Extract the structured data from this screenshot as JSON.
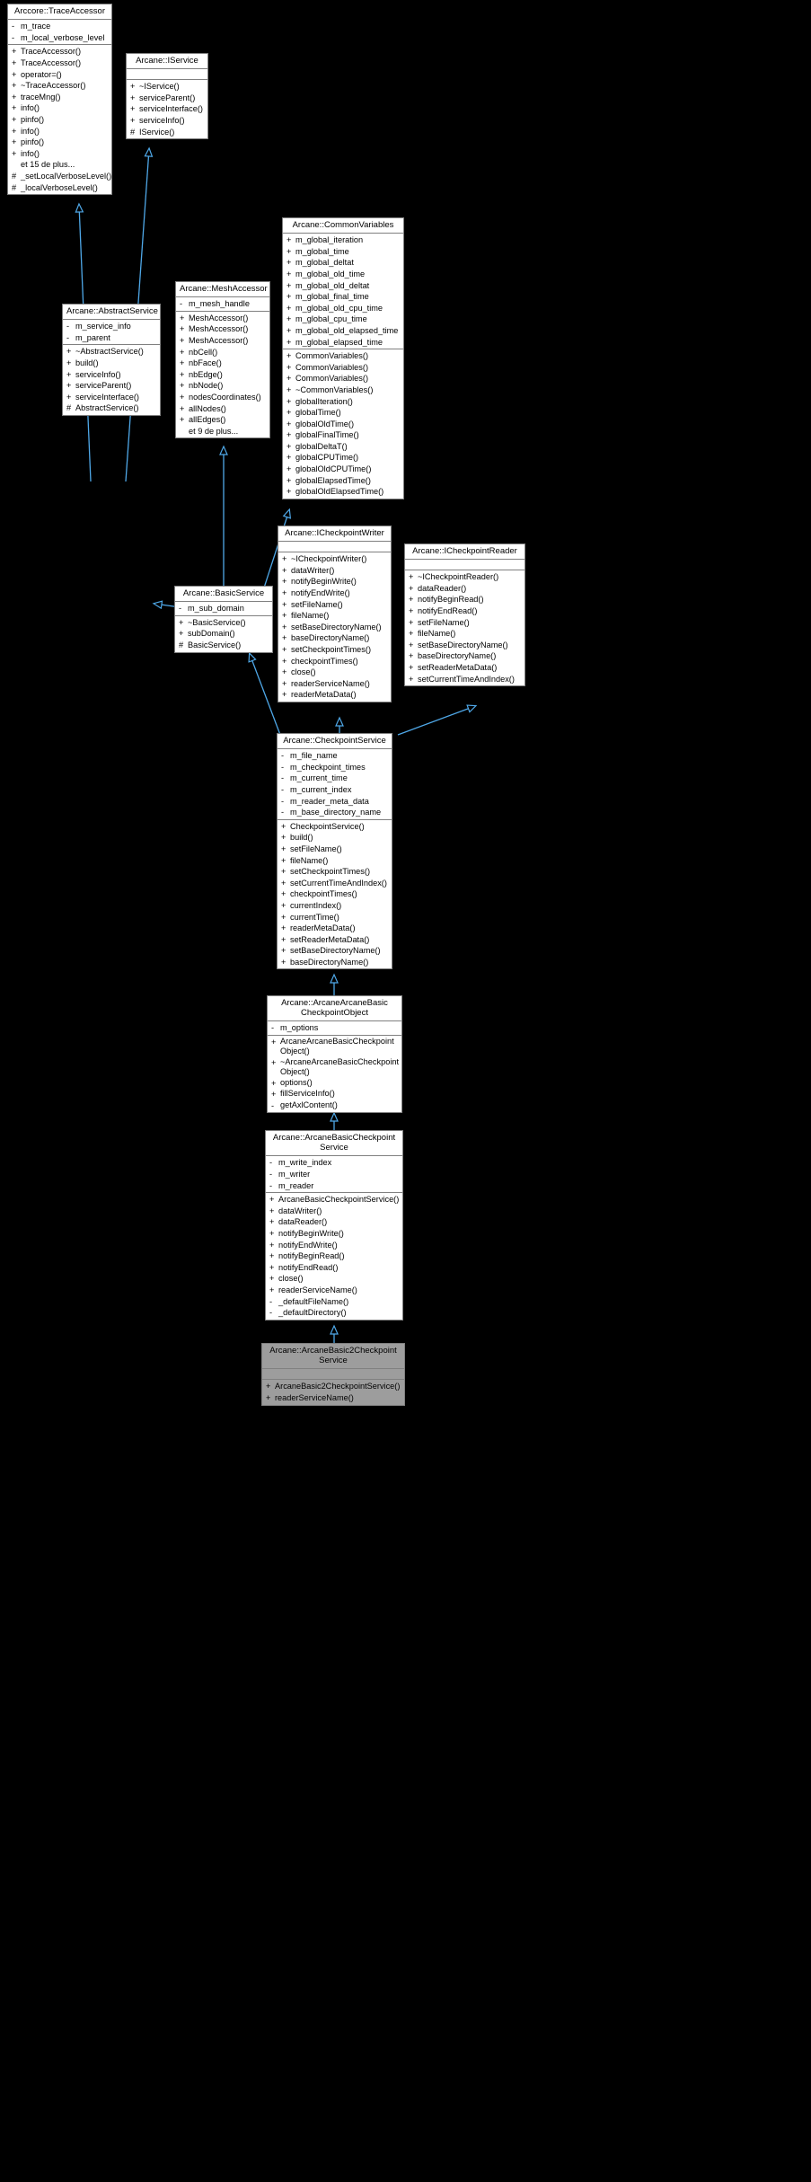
{
  "diagram": {
    "type": "uml-class-inheritance",
    "background": "#000000",
    "edge_color": "#4fa8e8",
    "node_fill": "#ffffff",
    "node_border": "#808080",
    "highlight_fill": "#9d9d9d"
  },
  "nodes": {
    "trace_accessor": {
      "title": "Arccore::TraceAccessor",
      "attributes": [
        {
          "vis": "-",
          "name": "m_trace"
        },
        {
          "vis": "-",
          "name": "m_local_verbose_level"
        }
      ],
      "methods": [
        {
          "vis": "+",
          "name": "TraceAccessor()"
        },
        {
          "vis": "+",
          "name": "TraceAccessor()"
        },
        {
          "vis": "+",
          "name": "operator=()"
        },
        {
          "vis": "+",
          "name": "~TraceAccessor()"
        },
        {
          "vis": "+",
          "name": "traceMng()"
        },
        {
          "vis": "+",
          "name": "info()"
        },
        {
          "vis": "+",
          "name": "pinfo()"
        },
        {
          "vis": "+",
          "name": "info()"
        },
        {
          "vis": "+",
          "name": "pinfo()"
        },
        {
          "vis": "+",
          "name": "info()"
        },
        {
          "vis": "",
          "name": "et 15 de plus..."
        },
        {
          "vis": "#",
          "name": "_setLocalVerboseLevel()"
        },
        {
          "vis": "#",
          "name": "_localVerboseLevel()"
        }
      ]
    },
    "iservice": {
      "title": "Arcane::IService",
      "attributes": [],
      "methods": [
        {
          "vis": "+",
          "name": "~IService()"
        },
        {
          "vis": "+",
          "name": "serviceParent()"
        },
        {
          "vis": "+",
          "name": "serviceInterface()"
        },
        {
          "vis": "+",
          "name": "serviceInfo()"
        },
        {
          "vis": "#",
          "name": "IService()"
        }
      ]
    },
    "abstract_service": {
      "title": "Arcane::AbstractService",
      "attributes": [
        {
          "vis": "-",
          "name": "m_service_info"
        },
        {
          "vis": "-",
          "name": "m_parent"
        }
      ],
      "methods": [
        {
          "vis": "+",
          "name": "~AbstractService()"
        },
        {
          "vis": "+",
          "name": "build()"
        },
        {
          "vis": "+",
          "name": "serviceInfo()"
        },
        {
          "vis": "+",
          "name": "serviceParent()"
        },
        {
          "vis": "+",
          "name": "serviceInterface()"
        },
        {
          "vis": "#",
          "name": "AbstractService()"
        }
      ]
    },
    "mesh_accessor": {
      "title": "Arcane::MeshAccessor",
      "attributes": [
        {
          "vis": "-",
          "name": "m_mesh_handle"
        }
      ],
      "methods": [
        {
          "vis": "+",
          "name": "MeshAccessor()"
        },
        {
          "vis": "+",
          "name": "MeshAccessor()"
        },
        {
          "vis": "+",
          "name": "MeshAccessor()"
        },
        {
          "vis": "+",
          "name": "nbCell()"
        },
        {
          "vis": "+",
          "name": "nbFace()"
        },
        {
          "vis": "+",
          "name": "nbEdge()"
        },
        {
          "vis": "+",
          "name": "nbNode()"
        },
        {
          "vis": "+",
          "name": "nodesCoordinates()"
        },
        {
          "vis": "+",
          "name": "allNodes()"
        },
        {
          "vis": "+",
          "name": "allEdges()"
        },
        {
          "vis": "",
          "name": "et 9 de plus..."
        }
      ]
    },
    "common_variables": {
      "title": "Arcane::CommonVariables",
      "attributes": [
        {
          "vis": "+",
          "name": "m_global_iteration"
        },
        {
          "vis": "+",
          "name": "m_global_time"
        },
        {
          "vis": "+",
          "name": "m_global_deltat"
        },
        {
          "vis": "+",
          "name": "m_global_old_time"
        },
        {
          "vis": "+",
          "name": "m_global_old_deltat"
        },
        {
          "vis": "+",
          "name": "m_global_final_time"
        },
        {
          "vis": "+",
          "name": "m_global_old_cpu_time"
        },
        {
          "vis": "+",
          "name": "m_global_cpu_time"
        },
        {
          "vis": "+",
          "name": "m_global_old_elapsed_time"
        },
        {
          "vis": "+",
          "name": "m_global_elapsed_time"
        }
      ],
      "methods": [
        {
          "vis": "+",
          "name": "CommonVariables()"
        },
        {
          "vis": "+",
          "name": "CommonVariables()"
        },
        {
          "vis": "+",
          "name": "CommonVariables()"
        },
        {
          "vis": "+",
          "name": "~CommonVariables()"
        },
        {
          "vis": "+",
          "name": "globalIteration()"
        },
        {
          "vis": "+",
          "name": "globalTime()"
        },
        {
          "vis": "+",
          "name": "globalOldTime()"
        },
        {
          "vis": "+",
          "name": "globalFinalTime()"
        },
        {
          "vis": "+",
          "name": "globalDeltaT()"
        },
        {
          "vis": "+",
          "name": "globalCPUTime()"
        },
        {
          "vis": "+",
          "name": "globalOldCPUTime()"
        },
        {
          "vis": "+",
          "name": "globalElapsedTime()"
        },
        {
          "vis": "+",
          "name": "globalOldElapsedTime()"
        }
      ]
    },
    "basic_service": {
      "title": "Arcane::BasicService",
      "attributes": [
        {
          "vis": "-",
          "name": "m_sub_domain"
        }
      ],
      "methods": [
        {
          "vis": "+",
          "name": "~BasicService()"
        },
        {
          "vis": "+",
          "name": "subDomain()"
        },
        {
          "vis": "#",
          "name": "BasicService()"
        }
      ]
    },
    "icheckpoint_writer": {
      "title": "Arcane::ICheckpointWriter",
      "attributes": [],
      "methods": [
        {
          "vis": "+",
          "name": "~ICheckpointWriter()"
        },
        {
          "vis": "+",
          "name": "dataWriter()"
        },
        {
          "vis": "+",
          "name": "notifyBeginWrite()"
        },
        {
          "vis": "+",
          "name": "notifyEndWrite()"
        },
        {
          "vis": "+",
          "name": "setFileName()"
        },
        {
          "vis": "+",
          "name": "fileName()"
        },
        {
          "vis": "+",
          "name": "setBaseDirectoryName()"
        },
        {
          "vis": "+",
          "name": "baseDirectoryName()"
        },
        {
          "vis": "+",
          "name": "setCheckpointTimes()"
        },
        {
          "vis": "+",
          "name": "checkpointTimes()"
        },
        {
          "vis": "+",
          "name": "close()"
        },
        {
          "vis": "+",
          "name": "readerServiceName()"
        },
        {
          "vis": "+",
          "name": "readerMetaData()"
        }
      ]
    },
    "icheckpoint_reader": {
      "title": "Arcane::ICheckpointReader",
      "attributes": [],
      "methods": [
        {
          "vis": "+",
          "name": "~ICheckpointReader()"
        },
        {
          "vis": "+",
          "name": "dataReader()"
        },
        {
          "vis": "+",
          "name": "notifyBeginRead()"
        },
        {
          "vis": "+",
          "name": "notifyEndRead()"
        },
        {
          "vis": "+",
          "name": "setFileName()"
        },
        {
          "vis": "+",
          "name": "fileName()"
        },
        {
          "vis": "+",
          "name": "setBaseDirectoryName()"
        },
        {
          "vis": "+",
          "name": "baseDirectoryName()"
        },
        {
          "vis": "+",
          "name": "setReaderMetaData()"
        },
        {
          "vis": "+",
          "name": "setCurrentTimeAndIndex()"
        }
      ]
    },
    "checkpoint_service": {
      "title": "Arcane::CheckpointService",
      "attributes": [
        {
          "vis": "-",
          "name": "m_file_name"
        },
        {
          "vis": "-",
          "name": "m_checkpoint_times"
        },
        {
          "vis": "-",
          "name": "m_current_time"
        },
        {
          "vis": "-",
          "name": "m_current_index"
        },
        {
          "vis": "-",
          "name": "m_reader_meta_data"
        },
        {
          "vis": "-",
          "name": "m_base_directory_name"
        }
      ],
      "methods": [
        {
          "vis": "+",
          "name": "CheckpointService()"
        },
        {
          "vis": "+",
          "name": "build()"
        },
        {
          "vis": "+",
          "name": "setFileName()"
        },
        {
          "vis": "+",
          "name": "fileName()"
        },
        {
          "vis": "+",
          "name": "setCheckpointTimes()"
        },
        {
          "vis": "+",
          "name": "setCurrentTimeAndIndex()"
        },
        {
          "vis": "+",
          "name": "checkpointTimes()"
        },
        {
          "vis": "+",
          "name": "currentIndex()"
        },
        {
          "vis": "+",
          "name": "currentTime()"
        },
        {
          "vis": "+",
          "name": "readerMetaData()"
        },
        {
          "vis": "+",
          "name": "setReaderMetaData()"
        },
        {
          "vis": "+",
          "name": "setBaseDirectoryName()"
        },
        {
          "vis": "+",
          "name": "baseDirectoryName()"
        }
      ]
    },
    "arcane_arcane_basic_checkpoint_object": {
      "title": "Arcane::ArcaneArcaneBasic\nCheckpointObject",
      "attributes": [
        {
          "vis": "-",
          "name": "m_options"
        }
      ],
      "methods": [
        {
          "vis": "+",
          "name": "ArcaneArcaneBasicCheckpoint\nObject()"
        },
        {
          "vis": "+",
          "name": "~ArcaneArcaneBasicCheckpoint\nObject()"
        },
        {
          "vis": "+",
          "name": "options()"
        },
        {
          "vis": "+",
          "name": "fillServiceInfo()"
        },
        {
          "vis": "-",
          "name": "getAxlContent()"
        }
      ]
    },
    "arcane_basic_checkpoint_service": {
      "title": "Arcane::ArcaneBasicCheckpoint\nService",
      "attributes": [
        {
          "vis": "-",
          "name": "m_write_index"
        },
        {
          "vis": "-",
          "name": "m_writer"
        },
        {
          "vis": "-",
          "name": "m_reader"
        }
      ],
      "methods": [
        {
          "vis": "+",
          "name": "ArcaneBasicCheckpointService()"
        },
        {
          "vis": "+",
          "name": "dataWriter()"
        },
        {
          "vis": "+",
          "name": "dataReader()"
        },
        {
          "vis": "+",
          "name": "notifyBeginWrite()"
        },
        {
          "vis": "+",
          "name": "notifyEndWrite()"
        },
        {
          "vis": "+",
          "name": "notifyBeginRead()"
        },
        {
          "vis": "+",
          "name": "notifyEndRead()"
        },
        {
          "vis": "+",
          "name": "close()"
        },
        {
          "vis": "+",
          "name": "readerServiceName()"
        },
        {
          "vis": "-",
          "name": "_defaultFileName()"
        },
        {
          "vis": "-",
          "name": "_defaultDirectory()"
        }
      ]
    },
    "arcane_basic2_checkpoint_service": {
      "title": "Arcane::ArcaneBasic2Checkpoint\nService",
      "attributes": [],
      "methods": [
        {
          "vis": "+",
          "name": "ArcaneBasic2CheckpointService()"
        },
        {
          "vis": "+",
          "name": "readerServiceName()"
        }
      ]
    }
  },
  "edges": [
    {
      "from": "abstract_service",
      "to": "trace_accessor",
      "kind": "inheritance"
    },
    {
      "from": "abstract_service",
      "to": "iservice",
      "kind": "inheritance"
    },
    {
      "from": "basic_service",
      "to": "abstract_service",
      "kind": "inheritance"
    },
    {
      "from": "basic_service",
      "to": "mesh_accessor",
      "kind": "inheritance"
    },
    {
      "from": "basic_service",
      "to": "common_variables",
      "kind": "inheritance"
    },
    {
      "from": "checkpoint_service",
      "to": "basic_service",
      "kind": "inheritance"
    },
    {
      "from": "checkpoint_service",
      "to": "icheckpoint_writer",
      "kind": "inheritance"
    },
    {
      "from": "checkpoint_service",
      "to": "icheckpoint_reader",
      "kind": "inheritance"
    },
    {
      "from": "arcane_arcane_basic_checkpoint_object",
      "to": "checkpoint_service",
      "kind": "inheritance"
    },
    {
      "from": "arcane_basic_checkpoint_service",
      "to": "arcane_arcane_basic_checkpoint_object",
      "kind": "inheritance"
    },
    {
      "from": "arcane_basic2_checkpoint_service",
      "to": "arcane_basic_checkpoint_service",
      "kind": "inheritance"
    }
  ]
}
